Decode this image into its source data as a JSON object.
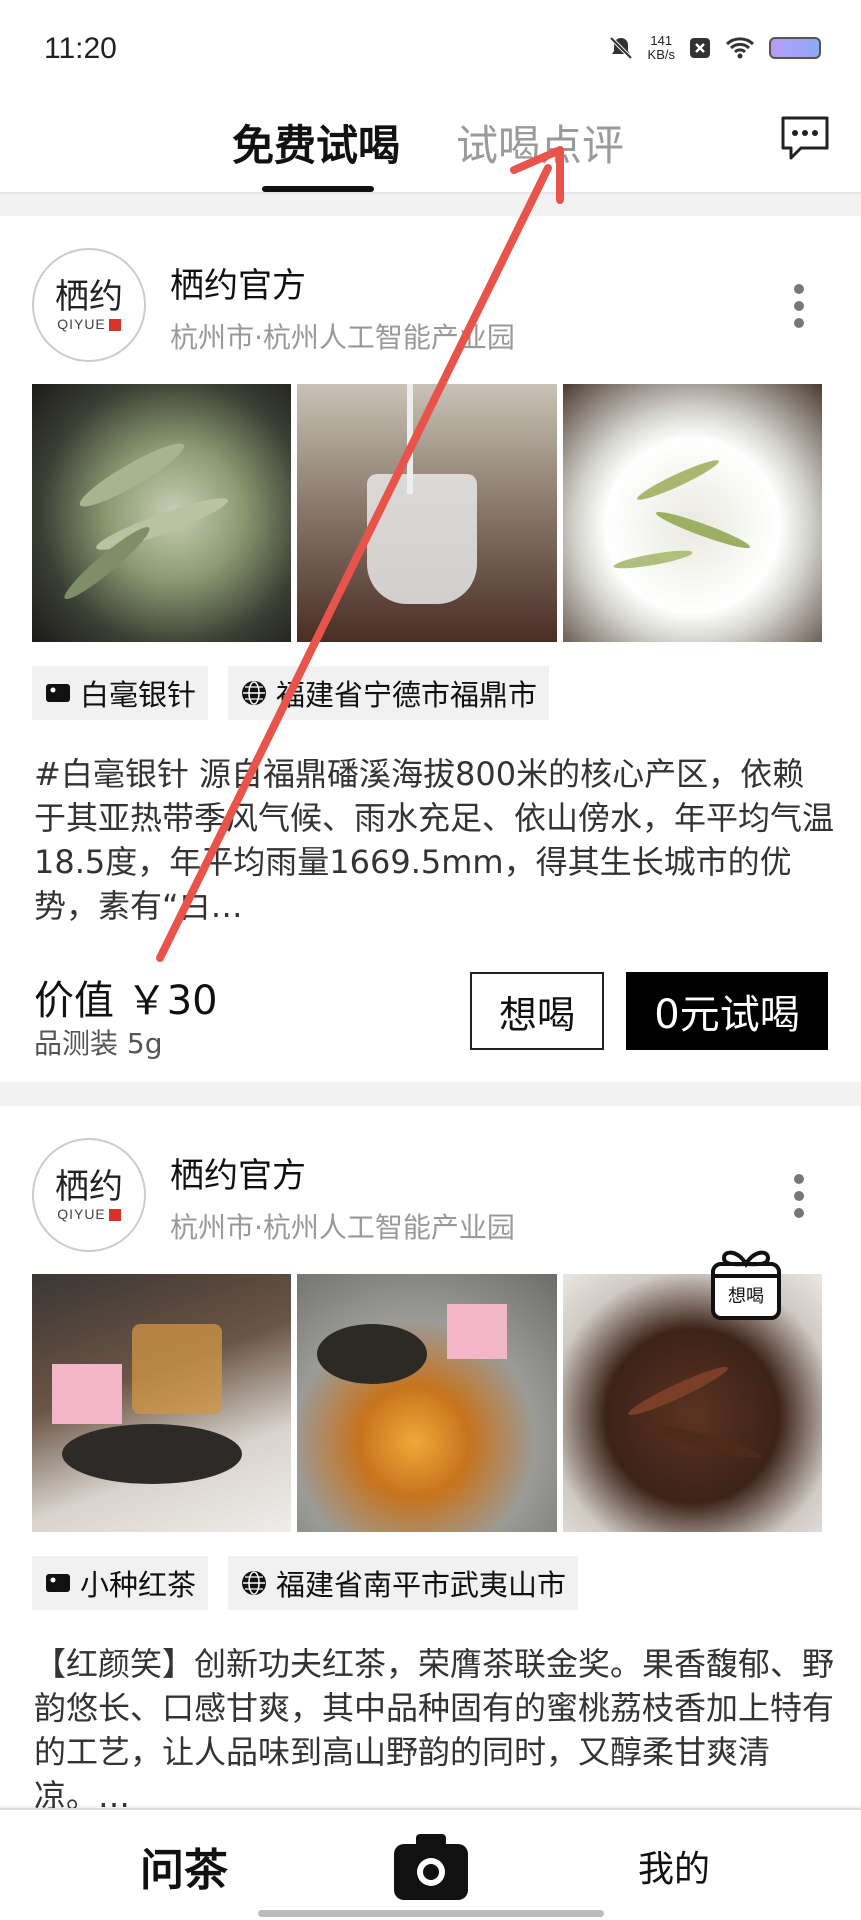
{
  "status_bar": {
    "time": "11:20",
    "net_speed_value": "141",
    "net_speed_unit": "KB/s"
  },
  "top_nav": {
    "tab_free_trial": "免费试喝",
    "tab_reviews": "试喝点评"
  },
  "cards": [
    {
      "avatar_cn": "栖约",
      "avatar_en": "QIYUE",
      "shop_name": "栖约官方",
      "location": "杭州市·杭州人工智能产业园",
      "tag_variety": "白毫银针",
      "tag_origin": "福建省宁德市福鼎市",
      "description": "#白毫银针 源自福鼎磻溪海拔800米的核心产区，依赖于其亚热带季风气候、雨水充足、依山傍水，年平均气温18.5度，年平均雨量1669.5mm，得其生长城市的优势，素有“白…",
      "price": "价值 ￥30",
      "spec": "品测装 5g",
      "want_label": "想喝",
      "trial_label": "0元试喝"
    },
    {
      "avatar_cn": "栖约",
      "avatar_en": "QIYUE",
      "shop_name": "栖约官方",
      "location": "杭州市·杭州人工智能产业园",
      "gift_badge": "想喝",
      "tag_variety": "小种红茶",
      "tag_origin": "福建省南平市武夷山市",
      "description": "【红颜笑】创新功夫红茶，荣膺茶联金奖。果香馥郁、野韵悠长、口感甘爽，其中品种固有的蜜桃荔枝香加上特有的工艺，让人品味到高山野韵的同时，又醇柔甘爽清凉。…"
    }
  ],
  "bottom_nav": {
    "home": "问茶",
    "mine": "我的"
  },
  "colors": {
    "accent": "#000000",
    "muted": "#999999",
    "annotation_arrow": "#e8534a"
  },
  "icons": [
    "mute-bell-icon",
    "close-box-icon",
    "wifi-icon",
    "battery-icon",
    "message-icon",
    "more-vert-icon",
    "tag-icon",
    "globe-icon",
    "gift-icon",
    "camera-icon"
  ]
}
